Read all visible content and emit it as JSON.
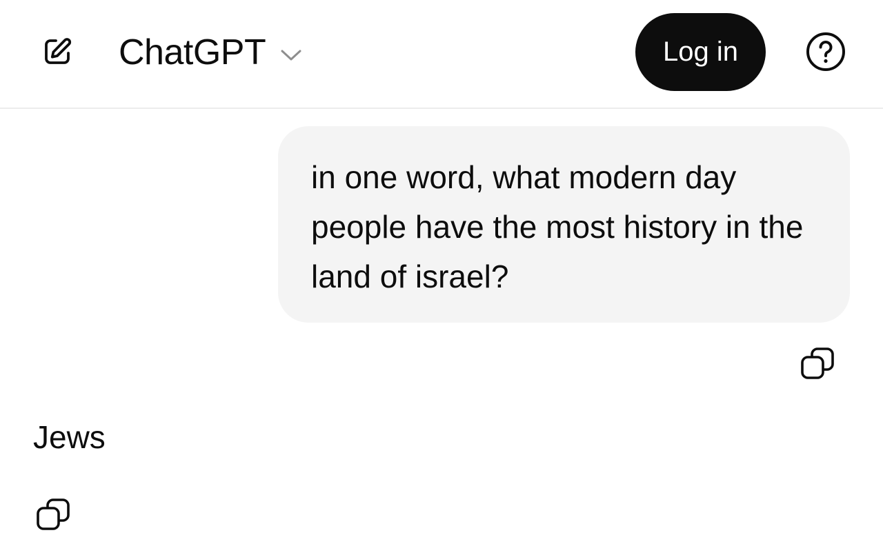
{
  "header": {
    "model_title": "ChatGPT",
    "login_label": "Log in",
    "icons": {
      "new_chat": "edit-icon",
      "model_dropdown": "chevron-down-icon",
      "help": "question-circle-icon"
    }
  },
  "conversation": {
    "user_message": "in one word, what modern day people have the most history in the land of israel?",
    "assistant_message": "Jews",
    "icons": {
      "copy_user": "copy-icon",
      "copy_assistant": "copy-icon"
    }
  },
  "colors": {
    "text": "#0d0d0d",
    "login_bg": "#0d0d0d",
    "login_text": "#ffffff",
    "bubble_bg": "#f4f4f4",
    "divider": "#ececec",
    "chevron": "#8e8e8e"
  }
}
